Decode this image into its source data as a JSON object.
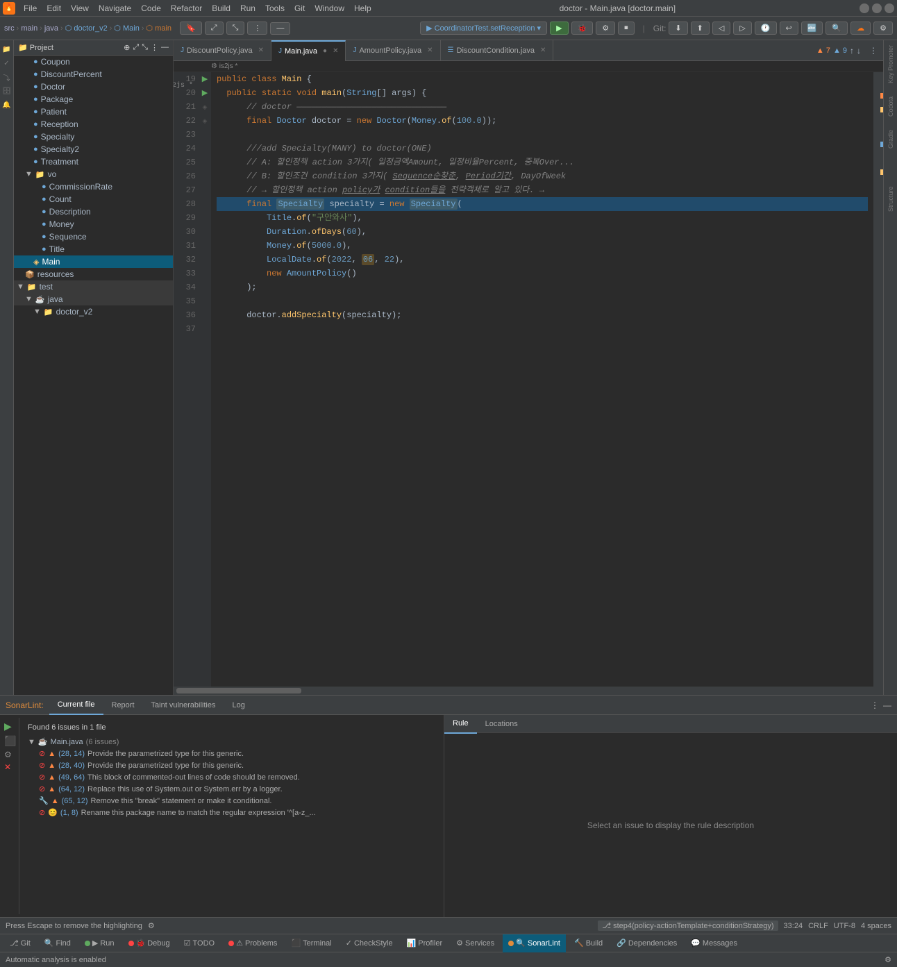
{
  "window": {
    "title": "doctor - Main.java [doctor.main]",
    "controls": {
      "min": "—",
      "max": "□",
      "close": "✕"
    }
  },
  "menu": {
    "items": [
      "File",
      "Edit",
      "View",
      "Navigate",
      "Code",
      "Refactor",
      "Build",
      "Run",
      "Tools",
      "Git",
      "Window",
      "Help"
    ]
  },
  "toolbar": {
    "breadcrumb": [
      "src",
      "main",
      "java",
      "doctor_v2",
      "Main",
      "main"
    ],
    "run_config": "CoordinatorTest.setReception",
    "git_label": "Git:"
  },
  "tabs": [
    {
      "label": "DiscountPolicy.java",
      "icon": "J",
      "active": false,
      "modified": false
    },
    {
      "label": "Main.java",
      "icon": "J",
      "active": true,
      "modified": true
    },
    {
      "label": "AmountPolicy.java",
      "icon": "J",
      "active": false,
      "modified": false
    },
    {
      "label": "DiscountCondition.java",
      "icon": "J",
      "active": false,
      "modified": false
    }
  ],
  "editor": {
    "lines": [
      {
        "num": 19,
        "run": "▶",
        "code": "public class Main {",
        "type": "normal"
      },
      {
        "num": 20,
        "run": "▶",
        "code": "    public static void main(String[] args) {",
        "type": "normal"
      },
      {
        "num": 21,
        "run": "",
        "code": "        // doctor ——————————————————————————————",
        "type": "comment"
      },
      {
        "num": 22,
        "run": "",
        "code": "        final Doctor doctor = new Doctor(Money.of(100.0));",
        "type": "normal"
      },
      {
        "num": 23,
        "run": "",
        "code": "",
        "type": "normal"
      },
      {
        "num": 24,
        "run": "",
        "code": "        ///add Specialty(MANY) to doctor(ONE)",
        "type": "comment"
      },
      {
        "num": 25,
        "run": "",
        "code": "        // A: 할인정책 action 3가지( 일정금액Amount, 일정비율Percent, 중복Over...",
        "type": "comment"
      },
      {
        "num": 26,
        "run": "",
        "code": "        // B: 할인조건 condition 3가지( Sequence순찾춘, Period기간, DayOfWeek",
        "type": "comment"
      },
      {
        "num": 27,
        "run": "",
        "code": "        // → 할인정책 action policy가 condition들을 전략객체로 알고 있다. →",
        "type": "comment"
      },
      {
        "num": 28,
        "run": "",
        "code": "        final Specialty specialty = new Specialty(",
        "type": "highlight"
      },
      {
        "num": 29,
        "run": "",
        "code": "                Title.of(\"구안와사\"),",
        "type": "normal"
      },
      {
        "num": 30,
        "run": "",
        "code": "                Duration.ofDays(60),",
        "type": "normal"
      },
      {
        "num": 31,
        "run": "",
        "code": "                Money.of(5000.0),",
        "type": "normal"
      },
      {
        "num": 32,
        "run": "",
        "code": "                LocalDate.of(2022, 06, 22),",
        "type": "normal"
      },
      {
        "num": 33,
        "run": "",
        "code": "                new AmountPolicy()",
        "type": "normal"
      },
      {
        "num": 34,
        "run": "",
        "code": "        );",
        "type": "normal"
      },
      {
        "num": 35,
        "run": "",
        "code": "",
        "type": "normal"
      },
      {
        "num": 36,
        "run": "",
        "code": "        doctor.addSpecialty(specialty);",
        "type": "normal"
      },
      {
        "num": 37,
        "run": "",
        "code": "",
        "type": "normal"
      }
    ]
  },
  "file_tree": {
    "items": [
      {
        "label": "Coupon",
        "indent": 2,
        "icon": "class"
      },
      {
        "label": "DiscountPercent",
        "indent": 2,
        "icon": "class"
      },
      {
        "label": "Doctor",
        "indent": 2,
        "icon": "class"
      },
      {
        "label": "Package",
        "indent": 2,
        "icon": "class"
      },
      {
        "label": "Patient",
        "indent": 2,
        "icon": "class"
      },
      {
        "label": "Reception",
        "indent": 2,
        "icon": "class"
      },
      {
        "label": "Specialty",
        "indent": 2,
        "icon": "class"
      },
      {
        "label": "Specialty2",
        "indent": 2,
        "icon": "class"
      },
      {
        "label": "Treatment",
        "indent": 2,
        "icon": "class"
      },
      {
        "label": "vo",
        "indent": 1,
        "icon": "folder"
      },
      {
        "label": "CommissionRate",
        "indent": 3,
        "icon": "class"
      },
      {
        "label": "Count",
        "indent": 3,
        "icon": "class"
      },
      {
        "label": "Description",
        "indent": 3,
        "icon": "class"
      },
      {
        "label": "Money",
        "indent": 3,
        "icon": "class"
      },
      {
        "label": "Sequence",
        "indent": 3,
        "icon": "class"
      },
      {
        "label": "Title",
        "indent": 3,
        "icon": "class"
      },
      {
        "label": "Main",
        "indent": 2,
        "icon": "class",
        "selected": true
      },
      {
        "label": "resources",
        "indent": 1,
        "icon": "resource"
      },
      {
        "label": "test",
        "indent": 0,
        "icon": "test-folder"
      },
      {
        "label": "java",
        "indent": 1,
        "icon": "test-folder"
      },
      {
        "label": "doctor_v2",
        "indent": 2,
        "icon": "folder"
      }
    ]
  },
  "sonarlint": {
    "tab_label": "SonarLint:",
    "tabs": [
      "Current file",
      "Report",
      "Taint vulnerabilities",
      "Log"
    ],
    "summary": "Found 6 issues in 1 file",
    "file_label": "Main.java",
    "issue_count": "(6 issues)",
    "issues": [
      {
        "line": 28,
        "col": 14,
        "severity": "error",
        "up": true,
        "text": "Provide the parametrized type for this generic."
      },
      {
        "line": 28,
        "col": 40,
        "severity": "error",
        "up": true,
        "text": "Provide the parametrized type for this generic."
      },
      {
        "line": 49,
        "col": 64,
        "severity": "error",
        "up": true,
        "text": "This block of commented-out lines of code should be removed."
      },
      {
        "line": 64,
        "col": 12,
        "severity": "error",
        "up": true,
        "text": "Replace this use of System.out or System.err by a logger."
      },
      {
        "line": 65,
        "col": 12,
        "severity": "warn",
        "up": true,
        "text": "Remove this \"break\" statement or make it conditional."
      },
      {
        "line": 1,
        "col": 8,
        "severity": "error",
        "up": "smiley",
        "text": "Rename this package name to match the regular expression '^[a-z_]..."
      }
    ],
    "rule_panel_text": "Select an issue to display the rule description"
  },
  "status_bar": {
    "escape_hint": "Press Escape to remove the highlighting",
    "position": "33:24",
    "line_ending": "CRLF",
    "encoding": "UTF-8",
    "indent": "4 spaces",
    "branch": "step4(policy-actionTemplate+conditionStrategy)"
  },
  "bottom_toolbar": {
    "items": [
      {
        "label": "Git",
        "icon": "git"
      },
      {
        "label": "Find",
        "icon": "find"
      },
      {
        "label": "Run",
        "icon": "run",
        "dot_color": "#5faa5f"
      },
      {
        "label": "Debug",
        "icon": "debug",
        "dot_color": "#ff4444"
      },
      {
        "label": "TODO",
        "icon": "todo"
      },
      {
        "label": "Problems",
        "icon": "problems",
        "dot_color": "#ff4444"
      },
      {
        "label": "Terminal",
        "icon": "terminal"
      },
      {
        "label": "CheckStyle",
        "icon": "checkstyle"
      },
      {
        "label": "Profiler",
        "icon": "profiler"
      },
      {
        "label": "Services",
        "icon": "services"
      },
      {
        "label": "SonarLint",
        "icon": "sonarlint",
        "active": true
      },
      {
        "label": "Build",
        "icon": "build"
      },
      {
        "label": "Dependencies",
        "icon": "dependencies"
      },
      {
        "label": "Messages",
        "icon": "messages"
      }
    ]
  }
}
